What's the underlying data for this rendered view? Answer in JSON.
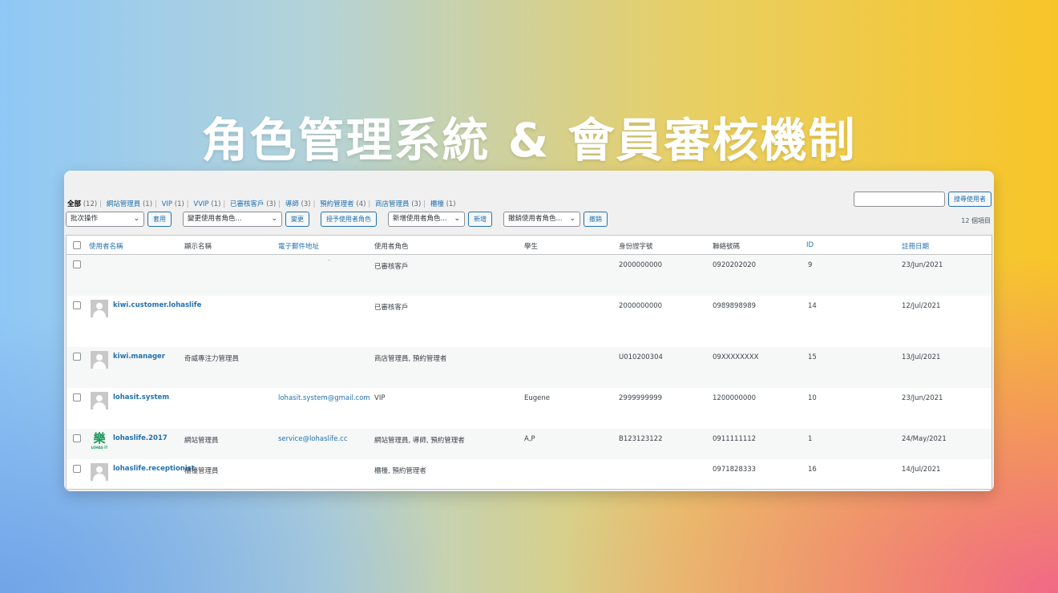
{
  "headline": "角色管理系統 & 會員審核機制",
  "filters": [
    {
      "label": "全部",
      "count": "(12)",
      "current": true
    },
    {
      "label": "網站管理員",
      "count": "(1)"
    },
    {
      "label": "VIP",
      "count": "(1)"
    },
    {
      "label": "VVIP",
      "count": "(1)"
    },
    {
      "label": "已審核客戶",
      "count": "(3)"
    },
    {
      "label": "導師",
      "count": "(3)"
    },
    {
      "label": "預約管理者",
      "count": "(4)"
    },
    {
      "label": "商店管理員",
      "count": "(3)"
    },
    {
      "label": "櫃檯",
      "count": "(1)"
    }
  ],
  "search": {
    "value": "",
    "button": "搜尋使用者"
  },
  "toolbar": {
    "bulk_select": "批次操作",
    "apply": "套用",
    "change_role_select": "變更使用者角色...",
    "change": "變更",
    "grant_role": "授予使用者角色",
    "add_role_select": "新增使用者角色...",
    "add": "新增",
    "revoke_role_select": "撤銷使用者角色...",
    "revoke": "撤銷",
    "chevron": "⌄"
  },
  "item_count": "12 個項目",
  "columns": {
    "username": "使用者名稱",
    "display": "顯示名稱",
    "email": "電子郵件地址",
    "role": "使用者角色",
    "student": "學生",
    "idno": "身份證字號",
    "phone": "聯絡號碼",
    "id": "ID",
    "registered": "註冊日期"
  },
  "rows": [
    {
      "avatar": "none",
      "username": "",
      "display": "",
      "email": "-",
      "role": "已審核客戶",
      "student": "",
      "idno": "2000000000",
      "phone": "0920202020",
      "id": "9",
      "registered": "23/Jun/2021"
    },
    {
      "avatar": "default-avatar-icon",
      "username": "kiwi.customer.lohaslife",
      "display": "",
      "email": "",
      "role": "已審核客戶",
      "student": "",
      "idno": "2000000000",
      "phone": "0989898989",
      "id": "14",
      "registered": "12/Jul/2021"
    },
    {
      "avatar": "default-avatar-icon",
      "username": "kiwi.manager",
      "display": "奇威專注力管理員",
      "email": "",
      "role": "商店管理員, 預約管理者",
      "student": "",
      "idno": "U010200304",
      "phone": "09XXXXXXXX",
      "id": "15",
      "registered": "13/Jul/2021"
    },
    {
      "avatar": "default-avatar-icon",
      "username": "lohasit.system",
      "display": "",
      "email": "lohasit.system@gmail.com",
      "role": "VIP",
      "student": "Eugene",
      "idno": "2999999999",
      "phone": "1200000000",
      "id": "10",
      "registered": "23/Jun/2021"
    },
    {
      "avatar": "lohas-logo-icon",
      "logo_text": "樂",
      "logo_sub": "LOHAS IT",
      "username": "lohaslife.2017",
      "display": "網站管理員",
      "email": "service@lohaslife.cc",
      "role": "網站管理員, 導師, 預約管理者",
      "student": "A,P",
      "idno": "B123123122",
      "phone": "0911111112",
      "id": "1",
      "registered": "24/May/2021"
    },
    {
      "avatar": "default-avatar-icon",
      "username": "lohaslife.receptionist",
      "display": "櫃檯管理員",
      "email": "",
      "role": "櫃檯, 預約管理者",
      "student": "",
      "idno": "",
      "phone": "0971828333",
      "id": "16",
      "registered": "14/Jul/2021"
    }
  ],
  "colors": {
    "link": "#2271b1",
    "panel_bg": "#f0f0f1",
    "headline": "#ffffff"
  }
}
